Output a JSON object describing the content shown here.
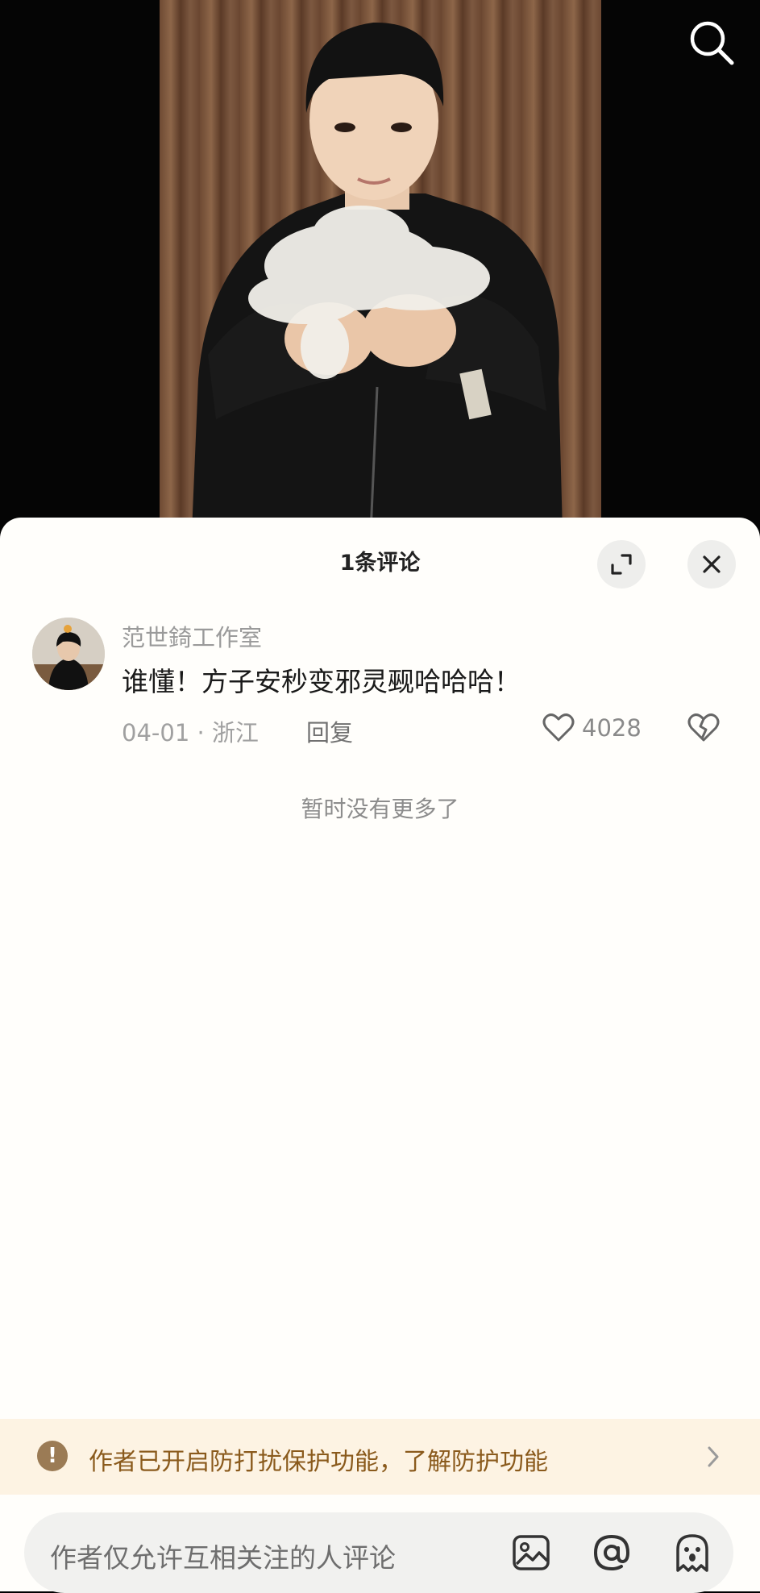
{
  "video": {
    "search_icon": "search-icon"
  },
  "comments_panel": {
    "title": "1条评论",
    "expand_icon": "expand-icon",
    "close_icon": "close-icon",
    "comments": [
      {
        "author": "范世錡工作室",
        "text": "谁懂！方子安秒变邪灵觋哈哈哈！",
        "date_location": "04-01 · 浙江",
        "reply_label": "回复",
        "like_count": "4028"
      }
    ],
    "no_more_text": "暂时没有更多了"
  },
  "protection_banner": {
    "text": "作者已开启防打扰保护功能，了解防护功能",
    "icon": "!"
  },
  "input_bar": {
    "placeholder": "作者仅允许互相关注的人评论"
  },
  "colors": {
    "banner_bg": "#fdf3e3",
    "banner_text": "#8a5a1c",
    "sheet_bg": "#fffefb"
  }
}
